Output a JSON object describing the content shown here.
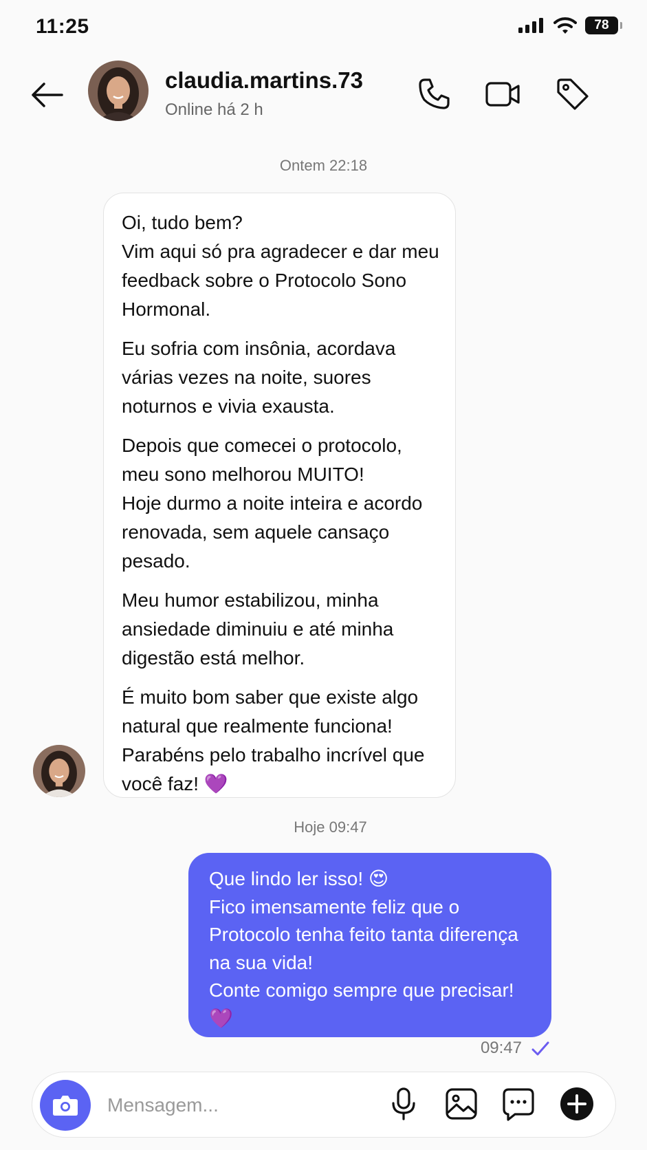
{
  "status_bar": {
    "time": "11:25",
    "battery": "78"
  },
  "header": {
    "username": "claudia.martins.73",
    "status": "Online há 2 h"
  },
  "conversation": {
    "timestamp_1": "Ontem 22:18",
    "incoming": {
      "paragraphs": [
        "Oi, tudo bem?\nVim aqui só pra agradecer e dar meu feedback sobre o Protocolo Sono Hormonal.",
        "Eu sofria com insônia, acordava várias vezes na noite, suores noturnos e vivia exausta.",
        "Depois que comecei o protocolo, meu sono melhorou MUITO!\nHoje durmo a noite inteira e acordo renovada, sem aquele cansaço pesado.",
        "Meu humor estabilizou, minha ansiedade diminuiu e até minha digestão está melhor.",
        "É muito bom saber que existe algo natural que realmente funciona! Parabéns pelo trabalho incrível que você faz! 💜"
      ]
    },
    "timestamp_2": "Hoje 09:47",
    "outgoing": {
      "text": "Que lindo ler isso! 😍\nFico imensamente feliz que o Protocolo tenha feito tanta diferença na sua vida!\nConte comigo sempre que precisar! 💜",
      "time": "09:47"
    }
  },
  "composer": {
    "placeholder": "Mensagem..."
  },
  "colors": {
    "accent": "#5b63f3",
    "read_check": "#6b5cf0"
  },
  "icons": [
    "back-arrow-icon",
    "phone-icon",
    "video-camera-icon",
    "tag-icon",
    "camera-icon",
    "microphone-icon",
    "image-icon",
    "sticker-icon",
    "plus-circle-icon",
    "check-icon",
    "signal-icon",
    "wifi-icon"
  ]
}
